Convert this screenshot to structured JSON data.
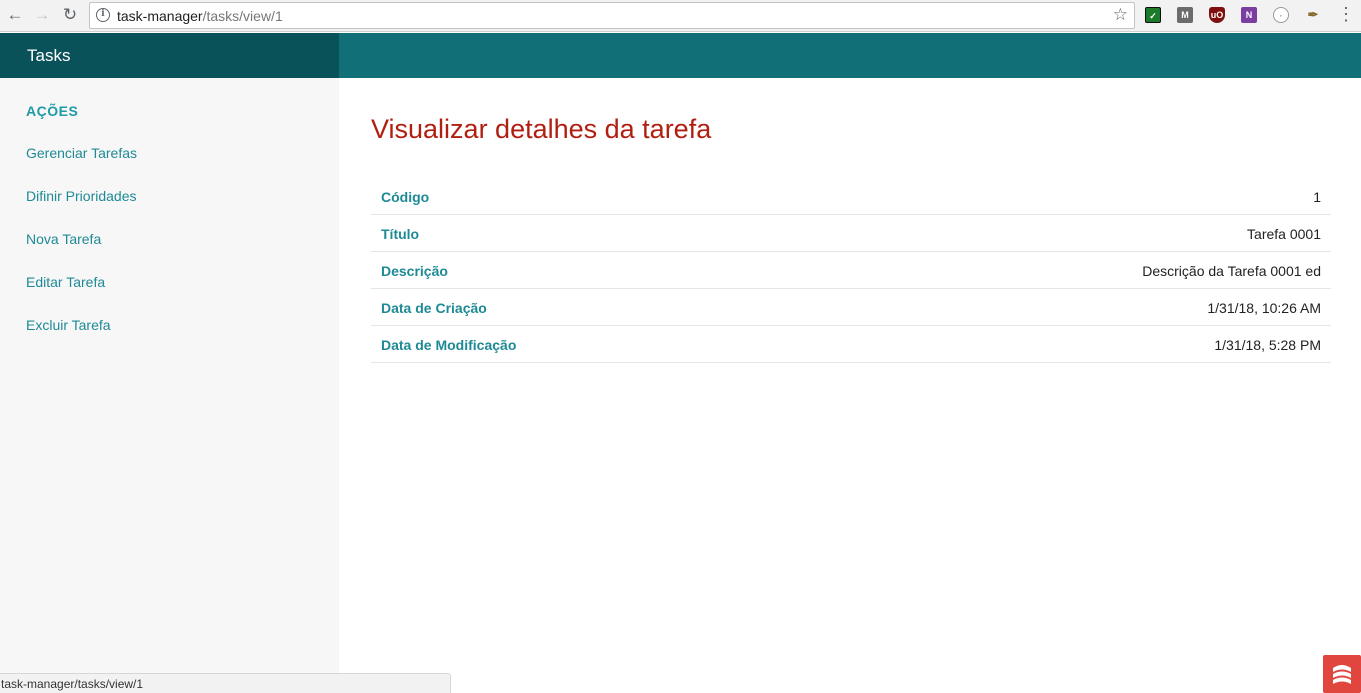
{
  "browser": {
    "url_host": "task-manager",
    "url_path": "/tasks/view/1"
  },
  "app": {
    "brand": "Tasks"
  },
  "sidebar": {
    "heading": "AÇÕES",
    "items": [
      {
        "label": "Gerenciar Tarefas"
      },
      {
        "label": "Difinir Prioridades"
      },
      {
        "label": "Nova Tarefa"
      },
      {
        "label": "Editar Tarefa"
      },
      {
        "label": "Excluir Tarefa"
      }
    ]
  },
  "main": {
    "title": "Visualizar detalhes da tarefa",
    "details": [
      {
        "label": "Código",
        "value": "1"
      },
      {
        "label": "Título",
        "value": "Tarefa 0001"
      },
      {
        "label": "Descrição",
        "value": "Descrição da Tarefa 0001 ed"
      },
      {
        "label": "Data de Criação",
        "value": "1/31/18, 10:26 AM"
      },
      {
        "label": "Data de Modificação",
        "value": "1/31/18, 5:28 PM"
      }
    ]
  },
  "status_bar": {
    "text": "task-manager/tasks/view/1"
  },
  "colors": {
    "header": "#116f78",
    "brand_bg": "#0a525a",
    "accent": "#1e8a96",
    "title": "#b01f10"
  }
}
